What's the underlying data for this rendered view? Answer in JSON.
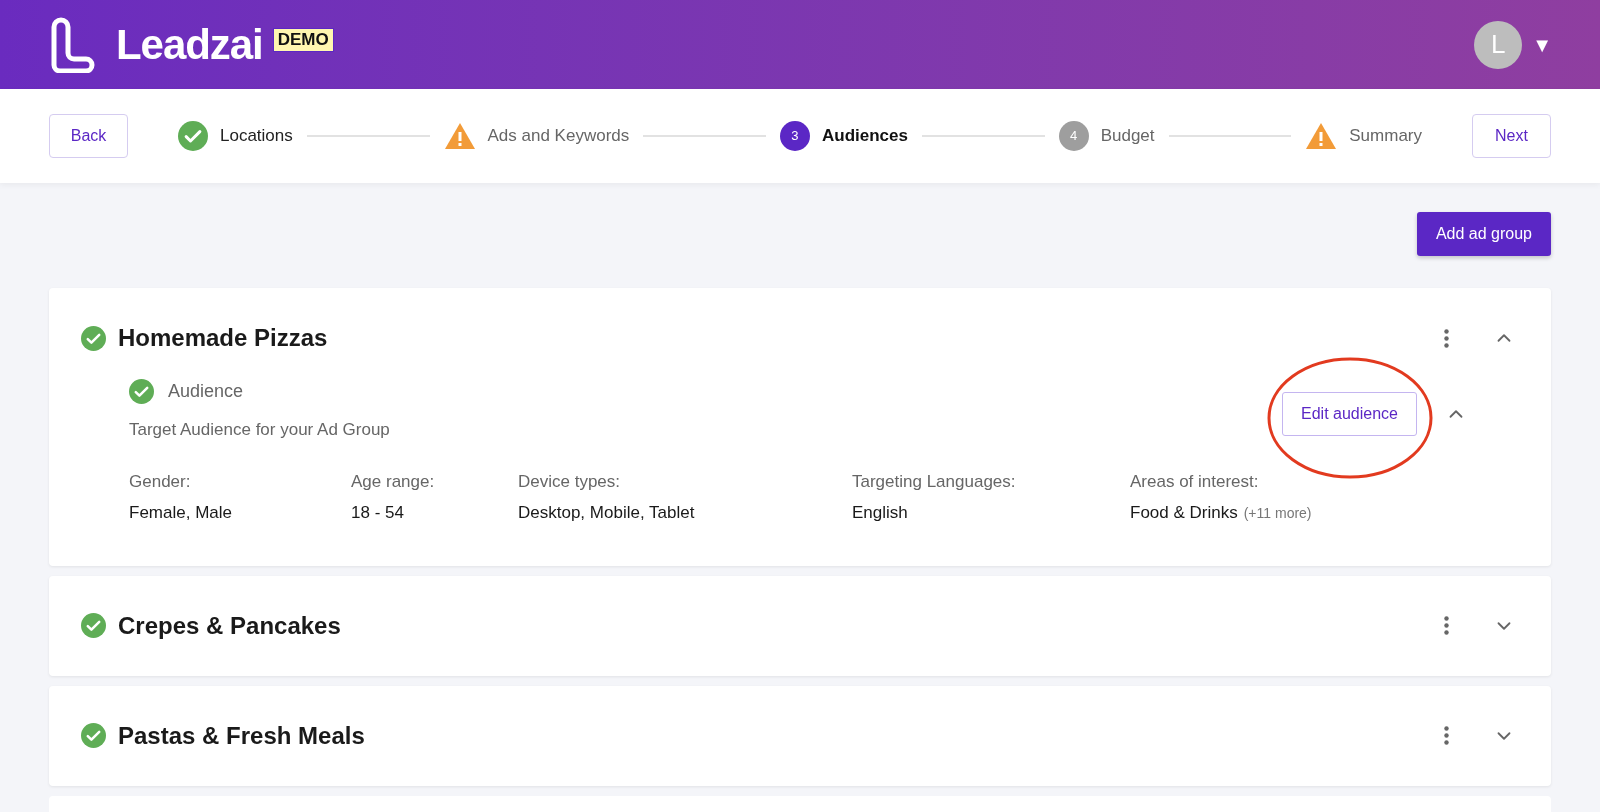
{
  "header": {
    "brand": "Leadzai",
    "badge": "DEMO",
    "avatar_letter": "L",
    "menu_caret": "▼"
  },
  "stepper": {
    "back": "Back",
    "next": "Next",
    "steps": [
      {
        "label": "Locations",
        "kind": "done",
        "selected": false
      },
      {
        "label": "Ads and Keywords",
        "kind": "warning",
        "selected": false
      },
      {
        "label": "Audiences",
        "kind": "number",
        "number": "3",
        "selected": true
      },
      {
        "label": "Budget",
        "kind": "number",
        "number": "4",
        "selected": false
      },
      {
        "label": "Summary",
        "kind": "warning",
        "selected": false
      }
    ]
  },
  "add_button": "Add ad group",
  "ad_groups": [
    {
      "title": "Homemade Pizzas",
      "complete": true,
      "expanded": true,
      "audience": {
        "title": "Audience",
        "complete": true,
        "expanded": true,
        "subtitle": "Target Audience for your Ad Group",
        "edit_button": "Edit audience",
        "annotated": true,
        "fields": [
          {
            "label": "Gender:",
            "value": "Female, Male"
          },
          {
            "label": "Age range:",
            "value": "18 - 54"
          },
          {
            "label": "Device types:",
            "value": "Desktop, Mobile, Tablet"
          },
          {
            "label": "Targeting Languages:",
            "value": "English"
          },
          {
            "label": "Areas of interest:",
            "value": "Food & Drinks",
            "extra": "(+11 more)"
          }
        ]
      }
    },
    {
      "title": "Crepes & Pancakes",
      "complete": true,
      "expanded": false
    },
    {
      "title": "Pastas & Fresh Meals",
      "complete": true,
      "expanded": false
    }
  ],
  "partial_card": true
}
